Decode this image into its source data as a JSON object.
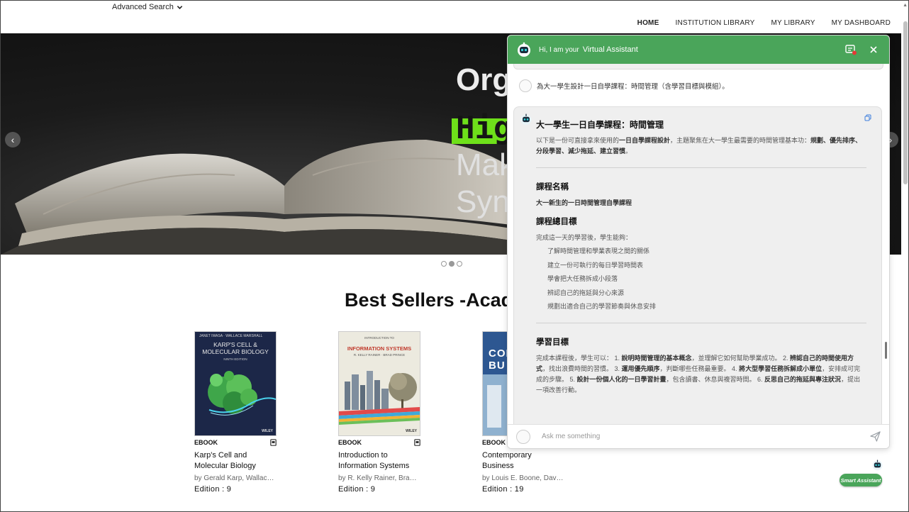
{
  "header": {
    "advanced_search": "Advanced Search",
    "nav": [
      "HOME",
      "INSTITUTION LIBRARY",
      "MY LIBRARY",
      "MY DASHBOARD"
    ]
  },
  "hero": {
    "line1": "Org",
    "line2": "High",
    "line3": "Mak",
    "line4": "Syn",
    "prev": "‹",
    "next": "›"
  },
  "section_title": "Best Sellers -Academi",
  "books": [
    {
      "type": "EBOOK",
      "title": "Karp's Cell and Molecular Biology",
      "author": "by Gerald Karp, Wallace ...",
      "edition": "Edition : 9",
      "cover_title": "KARP'S CELL & MOLECULAR BIOLOGY",
      "cover_authors": "JANET IWASA · WALLACE MARSHALL",
      "cover_edition": "NINTH EDITION",
      "publisher": "WILEY",
      "cover_color": "#1f2b4e"
    },
    {
      "type": "EBOOK",
      "title": "Introduction to Information Systems",
      "author": "by R. Kelly Rainer, Brad Pr...",
      "edition": "Edition : 9",
      "cover_small": "INTRODUCTION TO",
      "cover_title": "INFORMATION SYSTEMS",
      "cover_authors": "R. KELLY RAINER · BRAD PRINCE",
      "publisher": "WILEY",
      "cover_color": "#e9e7d9"
    },
    {
      "type": "EBOOK",
      "title": "Contemporary Business",
      "author": "by Louis E. Boone, David ...",
      "edition": "Edition : 19",
      "cover_title": "CON BU",
      "cover_color": "#2a4f86"
    }
  ],
  "chat": {
    "hi": "Hi, I am your",
    "assistant_name": "Virtual Assistant",
    "user_message": "為大一學生設計一日自學課程：時間管理（含學習目標與模組）。",
    "reply": {
      "title": "大一學生一日自學課程：時間管理",
      "intro_pre": "以下是一份可直接拿來使用的",
      "intro_bold1": "一日自學課程設計",
      "intro_mid": "，主題聚焦在大一學生最需要的時間管理基本功：",
      "intro_bold2": "規劃、優先排序、分段學習、減少拖延、建立習慣",
      "intro_end": "。",
      "course_name_heading": "課程名稱",
      "course_name": "大一新生的一日時間管理自學課程",
      "overall_goal_heading": "課程總目標",
      "overall_goal_intro": "完成這一天的學習後，學生能夠：",
      "overall_goals": [
        "了解時間管理和學業表現之間的關係",
        "建立一份可執行的每日學習時間表",
        "學會把大任務拆成小段落",
        "辨認自己的拖延與分心來源",
        "規劃出適合自己的學習節奏與休息安排"
      ],
      "learning_goal_heading": "學習目標",
      "lg_t1": "完成本課程後，學生可以： 1. ",
      "lg_b1": "說明時間管理的基本概念",
      "lg_t2": "，並理解它如何幫助學業成功。 2. ",
      "lg_b2": "辨認自己的時間使用方式",
      "lg_t3": "，找出浪費時間的習慣。 3. ",
      "lg_b3": "運用優先順序",
      "lg_t4": "，判斷哪些任務最重要。 4. ",
      "lg_b4": "將大型學習任務拆解成小單位",
      "lg_t5": "，安排成可完成的步驟。 5. ",
      "lg_b5": "設計一份個人化的一日學習計畫",
      "lg_t6": "，包含讀書、休息與複習時間。 6. ",
      "lg_b6": "反思自己的拖延與專注狀況",
      "lg_t7": "，提出一項改善行動。"
    },
    "input_placeholder": "Ask me something",
    "smart_assistant": "Smart Assistant"
  },
  "colors": {
    "chat_green": "#4aa55a",
    "highlight_green": "#6ee01a"
  },
  "icons": [
    "chevron-down-icon",
    "bot-avatar-icon",
    "new-chat-icon",
    "close-icon",
    "user-avatar-icon",
    "copy-icon",
    "send-icon",
    "ebook-icon",
    "arrow-left-icon",
    "arrow-right-icon"
  ]
}
